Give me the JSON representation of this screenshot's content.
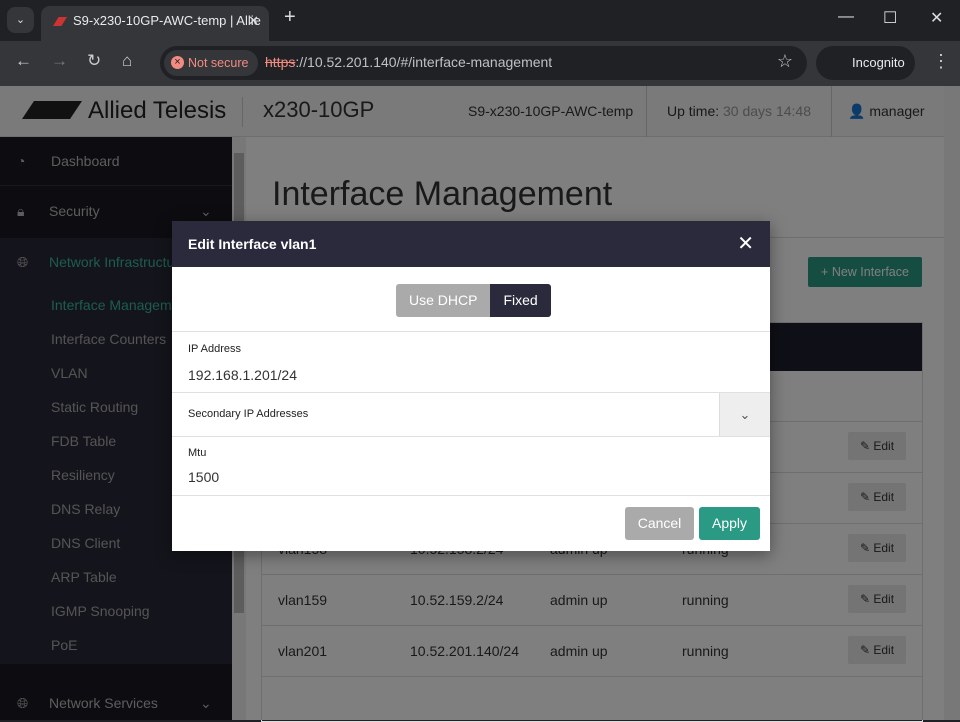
{
  "browser": {
    "tab_title": "S9-x230-10GP-AWC-temp | Allie",
    "security": "Not secure",
    "url_scheme": "https",
    "url_rest": "://10.52.201.140/#/interface-management",
    "profile": "Incognito"
  },
  "header": {
    "brand": "Allied Telesis",
    "model": "x230-10GP",
    "hostname": "S9-x230-10GP-AWC-temp",
    "uptime_label": "Up time:",
    "uptime_value": "30 days 14:48",
    "user": "manager"
  },
  "sidebar": {
    "items": [
      {
        "label": "Dashboard",
        "icon": "gauge-icon"
      },
      {
        "label": "Security",
        "icon": "lock-icon"
      },
      {
        "label": "Network Infrastructure",
        "icon": "globe-icon"
      }
    ],
    "subitems": [
      "Interface Management",
      "Interface Counters",
      "VLAN",
      "Static Routing",
      "FDB Table",
      "Resiliency",
      "DNS Relay",
      "DNS Client",
      "ARP Table",
      "IGMP Snooping",
      "PoE"
    ],
    "bottom": {
      "label": "Network Services",
      "icon": "globe-icon"
    }
  },
  "main": {
    "title": "Interface Management",
    "new_button": "New Interface",
    "edit_label": "Edit",
    "rows": [
      [
        "vlan158",
        "10.52.158.2/24",
        "admin up",
        "running"
      ],
      [
        "vlan159",
        "10.52.159.2/24",
        "admin up",
        "running"
      ],
      [
        "vlan201",
        "10.52.201.140/24",
        "admin up",
        "running"
      ]
    ]
  },
  "modal": {
    "title": "Edit Interface vlan1",
    "mode_dhcp": "Use DHCP",
    "mode_fixed": "Fixed",
    "selected_mode": "Fixed",
    "ip_label": "IP Address",
    "ip_value": "192.168.1.201/24",
    "secondary_label": "Secondary IP Addresses",
    "mtu_label": "Mtu",
    "mtu_value": "1500",
    "cancel": "Cancel",
    "apply": "Apply"
  },
  "colors": {
    "accent": "#2a9a85",
    "dark": "#2a2a3c"
  }
}
